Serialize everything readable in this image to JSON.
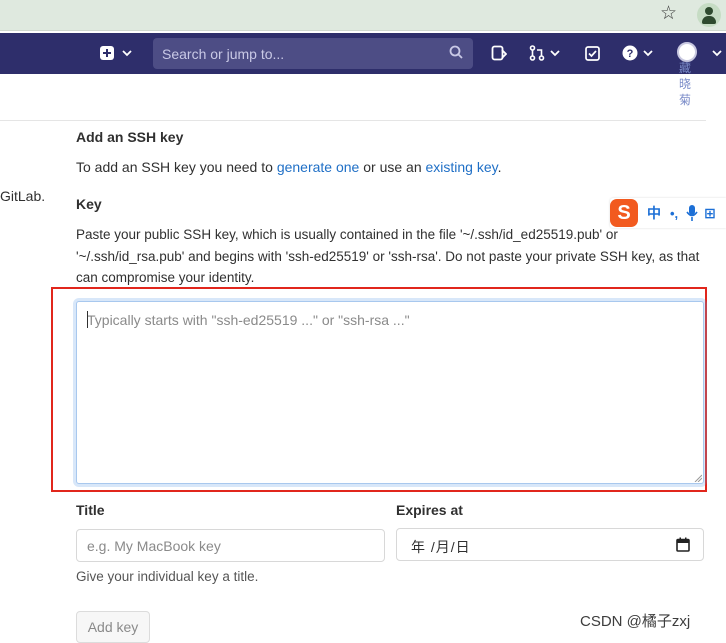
{
  "browser": {
    "star_icon": "star-icon",
    "profile_icon": "profile-icon"
  },
  "navbar": {
    "search_placeholder": "Search or jump to...",
    "vertical_name": "藏晓菊"
  },
  "left_fragment": "GitLab.",
  "section": {
    "title": "Add an SSH key",
    "intro_prefix": "To add an SSH key you need to ",
    "link1": "generate one",
    "intro_middle": " or use an ",
    "link2": "existing key",
    "intro_suffix": "."
  },
  "key": {
    "label": "Key",
    "help": "Paste your public SSH key, which is usually contained in the file '~/.ssh/id_ed25519.pub' or '~/.ssh/id_rsa.pub' and begins with 'ssh-ed25519' or 'ssh-rsa'. Do not paste your private SSH key, as that can compromise your identity.",
    "placeholder": "Typically starts with \"ssh-ed25519 ...\" or \"ssh-rsa ...\""
  },
  "ime": {
    "logo": "S",
    "lang": "中",
    "punct": "•,",
    "keyboard": "⊞"
  },
  "title_field": {
    "label": "Title",
    "placeholder": "e.g. My MacBook key",
    "hint": "Give your individual key a title."
  },
  "expires": {
    "label": "Expires at",
    "value": "年 /月/日"
  },
  "add_button": "Add key",
  "watermark": "CSDN @橘子zxj",
  "colors": {
    "navbar": "#2e2e6b",
    "link": "#1f6fc6",
    "highlight": "#e1261c"
  }
}
